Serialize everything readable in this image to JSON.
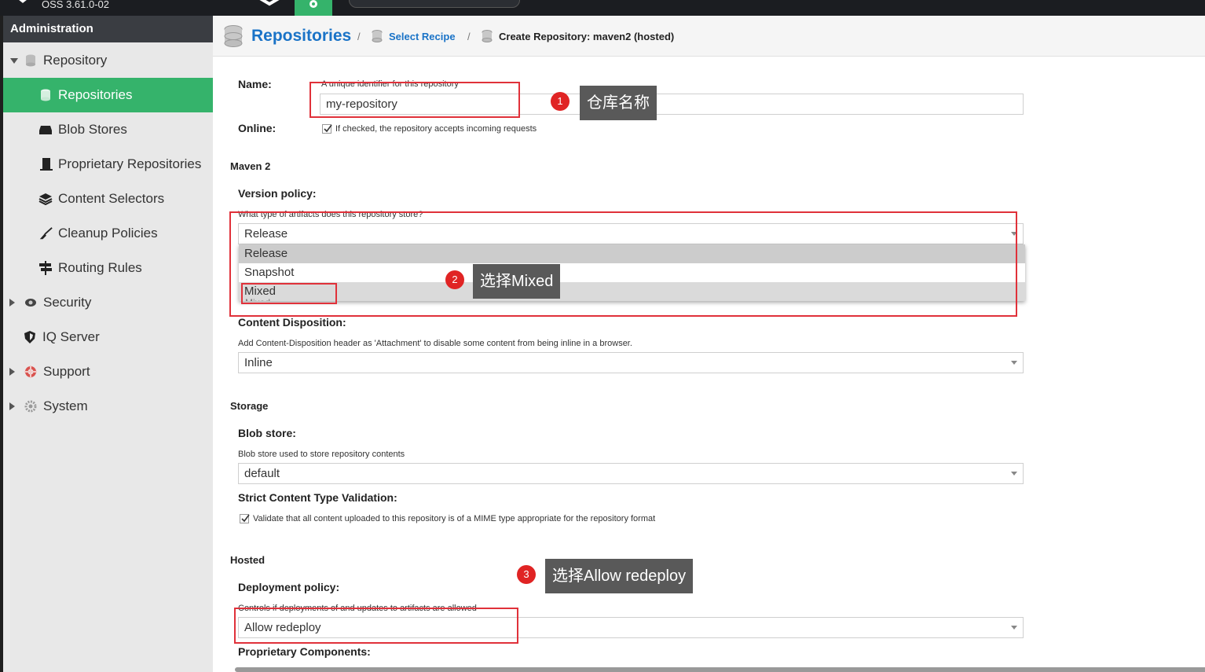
{
  "app": {
    "version": "OSS 3.61.0-02"
  },
  "sidebar": {
    "header": "Administration",
    "items": [
      {
        "label": "Repository"
      },
      {
        "label": "Repositories"
      },
      {
        "label": "Blob Stores"
      },
      {
        "label": "Proprietary Repositories"
      },
      {
        "label": "Content Selectors"
      },
      {
        "label": "Cleanup Policies"
      },
      {
        "label": "Routing Rules"
      },
      {
        "label": "Security"
      },
      {
        "label": "IQ Server"
      },
      {
        "label": "Support"
      },
      {
        "label": "System"
      }
    ]
  },
  "breadcrumb": {
    "title": "Repositories",
    "sep": "/",
    "link": "Select Recipe",
    "current": "Create Repository: maven2 (hosted)"
  },
  "form": {
    "name_label": "Name:",
    "name_help": "A unique identifier for this repository",
    "name_value": "my-repository",
    "online_label": "Online:",
    "online_help": "If checked, the repository accepts incoming requests",
    "maven_section": "Maven 2",
    "version_label": "Version policy:",
    "version_help": "What type of artifacts does this repository store?",
    "version_value": "Release",
    "version_options": [
      "Release",
      "Snapshot",
      "Mixed"
    ],
    "version_clipped": "Mixed",
    "disposition_label": "Content Disposition:",
    "disposition_help": "Add Content-Disposition header as 'Attachment' to disable some content from being inline in a browser.",
    "disposition_value": "Inline",
    "storage_section": "Storage",
    "blob_label": "Blob store:",
    "blob_help": "Blob store used to store repository contents",
    "blob_value": "default",
    "strict_label": "Strict Content Type Validation:",
    "strict_help": "Validate that all content uploaded to this repository is of a MIME type appropriate for the repository format",
    "hosted_section": "Hosted",
    "deploy_label": "Deployment policy:",
    "deploy_help": "Controls if deployments of and updates to artifacts are allowed",
    "deploy_value": "Allow redeploy",
    "proprietary_label": "Proprietary Components:"
  },
  "annotations": [
    {
      "num": "1",
      "text": "仓库名称"
    },
    {
      "num": "2",
      "text": "选择Mixed"
    },
    {
      "num": "3",
      "text": "选择Allow redeploy"
    }
  ],
  "colors": {
    "accent": "#35b36b",
    "link": "#1a73c7",
    "annotation": "#e0313a"
  }
}
